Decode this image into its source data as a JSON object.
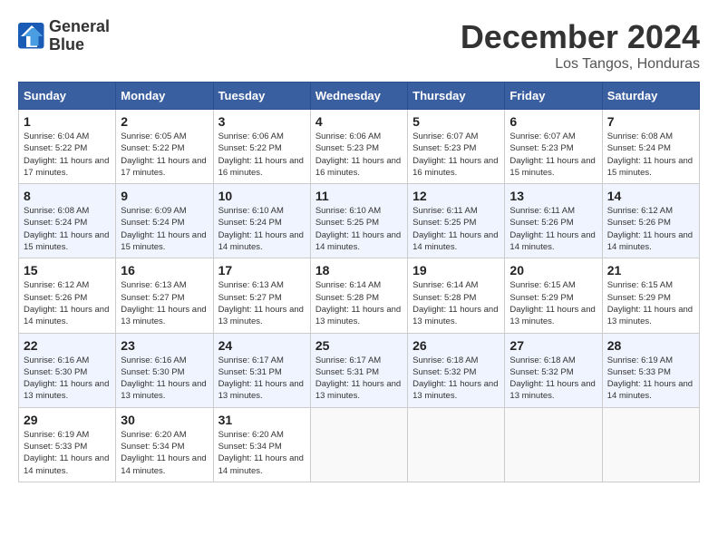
{
  "header": {
    "logo_line1": "General",
    "logo_line2": "Blue",
    "month": "December 2024",
    "location": "Los Tangos, Honduras"
  },
  "weekdays": [
    "Sunday",
    "Monday",
    "Tuesday",
    "Wednesday",
    "Thursday",
    "Friday",
    "Saturday"
  ],
  "weeks": [
    [
      {
        "day": "1",
        "sunrise": "6:04 AM",
        "sunset": "5:22 PM",
        "daylight": "11 hours and 17 minutes"
      },
      {
        "day": "2",
        "sunrise": "6:05 AM",
        "sunset": "5:22 PM",
        "daylight": "11 hours and 17 minutes"
      },
      {
        "day": "3",
        "sunrise": "6:06 AM",
        "sunset": "5:22 PM",
        "daylight": "11 hours and 16 minutes"
      },
      {
        "day": "4",
        "sunrise": "6:06 AM",
        "sunset": "5:23 PM",
        "daylight": "11 hours and 16 minutes"
      },
      {
        "day": "5",
        "sunrise": "6:07 AM",
        "sunset": "5:23 PM",
        "daylight": "11 hours and 16 minutes"
      },
      {
        "day": "6",
        "sunrise": "6:07 AM",
        "sunset": "5:23 PM",
        "daylight": "11 hours and 15 minutes"
      },
      {
        "day": "7",
        "sunrise": "6:08 AM",
        "sunset": "5:24 PM",
        "daylight": "11 hours and 15 minutes"
      }
    ],
    [
      {
        "day": "8",
        "sunrise": "6:08 AM",
        "sunset": "5:24 PM",
        "daylight": "11 hours and 15 minutes"
      },
      {
        "day": "9",
        "sunrise": "6:09 AM",
        "sunset": "5:24 PM",
        "daylight": "11 hours and 15 minutes"
      },
      {
        "day": "10",
        "sunrise": "6:10 AM",
        "sunset": "5:24 PM",
        "daylight": "11 hours and 14 minutes"
      },
      {
        "day": "11",
        "sunrise": "6:10 AM",
        "sunset": "5:25 PM",
        "daylight": "11 hours and 14 minutes"
      },
      {
        "day": "12",
        "sunrise": "6:11 AM",
        "sunset": "5:25 PM",
        "daylight": "11 hours and 14 minutes"
      },
      {
        "day": "13",
        "sunrise": "6:11 AM",
        "sunset": "5:26 PM",
        "daylight": "11 hours and 14 minutes"
      },
      {
        "day": "14",
        "sunrise": "6:12 AM",
        "sunset": "5:26 PM",
        "daylight": "11 hours and 14 minutes"
      }
    ],
    [
      {
        "day": "15",
        "sunrise": "6:12 AM",
        "sunset": "5:26 PM",
        "daylight": "11 hours and 14 minutes"
      },
      {
        "day": "16",
        "sunrise": "6:13 AM",
        "sunset": "5:27 PM",
        "daylight": "11 hours and 13 minutes"
      },
      {
        "day": "17",
        "sunrise": "6:13 AM",
        "sunset": "5:27 PM",
        "daylight": "11 hours and 13 minutes"
      },
      {
        "day": "18",
        "sunrise": "6:14 AM",
        "sunset": "5:28 PM",
        "daylight": "11 hours and 13 minutes"
      },
      {
        "day": "19",
        "sunrise": "6:14 AM",
        "sunset": "5:28 PM",
        "daylight": "11 hours and 13 minutes"
      },
      {
        "day": "20",
        "sunrise": "6:15 AM",
        "sunset": "5:29 PM",
        "daylight": "11 hours and 13 minutes"
      },
      {
        "day": "21",
        "sunrise": "6:15 AM",
        "sunset": "5:29 PM",
        "daylight": "11 hours and 13 minutes"
      }
    ],
    [
      {
        "day": "22",
        "sunrise": "6:16 AM",
        "sunset": "5:30 PM",
        "daylight": "11 hours and 13 minutes"
      },
      {
        "day": "23",
        "sunrise": "6:16 AM",
        "sunset": "5:30 PM",
        "daylight": "11 hours and 13 minutes"
      },
      {
        "day": "24",
        "sunrise": "6:17 AM",
        "sunset": "5:31 PM",
        "daylight": "11 hours and 13 minutes"
      },
      {
        "day": "25",
        "sunrise": "6:17 AM",
        "sunset": "5:31 PM",
        "daylight": "11 hours and 13 minutes"
      },
      {
        "day": "26",
        "sunrise": "6:18 AM",
        "sunset": "5:32 PM",
        "daylight": "11 hours and 13 minutes"
      },
      {
        "day": "27",
        "sunrise": "6:18 AM",
        "sunset": "5:32 PM",
        "daylight": "11 hours and 13 minutes"
      },
      {
        "day": "28",
        "sunrise": "6:19 AM",
        "sunset": "5:33 PM",
        "daylight": "11 hours and 14 minutes"
      }
    ],
    [
      {
        "day": "29",
        "sunrise": "6:19 AM",
        "sunset": "5:33 PM",
        "daylight": "11 hours and 14 minutes"
      },
      {
        "day": "30",
        "sunrise": "6:20 AM",
        "sunset": "5:34 PM",
        "daylight": "11 hours and 14 minutes"
      },
      {
        "day": "31",
        "sunrise": "6:20 AM",
        "sunset": "5:34 PM",
        "daylight": "11 hours and 14 minutes"
      },
      null,
      null,
      null,
      null
    ]
  ]
}
